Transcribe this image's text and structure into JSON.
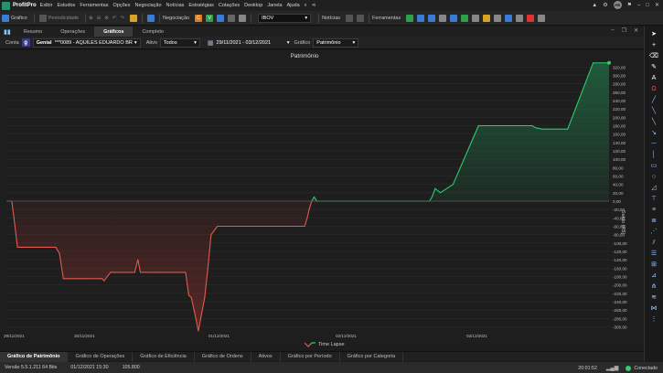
{
  "menubar": {
    "app_title": "ProfitPro",
    "items": [
      "Exibir",
      "Estudos",
      "Ferramentas",
      "Opções",
      "Negociação",
      "Notícias",
      "Estratégias",
      "Cotações",
      "Desktop",
      "Janela",
      "Ajuda"
    ],
    "avatar_text": "AE"
  },
  "toolbar": {
    "chart_label": "Gráfico",
    "periodicity_label": "Periodicidade",
    "negotiation_label": "Negociação",
    "buy_letter": "C",
    "sell_letter": "V",
    "symbol_value": "IBOV",
    "news_label": "Notícias",
    "tools_label": "Ferramentas"
  },
  "tabs": [
    {
      "label": "Resumo",
      "active": false
    },
    {
      "label": "Operações",
      "active": false
    },
    {
      "label": "Gráficos",
      "active": true
    },
    {
      "label": "Completo",
      "active": false
    }
  ],
  "filters": {
    "account_label": "Conta",
    "broker_icon_letter": "g",
    "broker_name": "Genial",
    "account_value": "***0089 - AQUILES EDUARDO BR",
    "asset_label": "Ativo",
    "asset_value": "Todos",
    "date_range": "29/11/2021 - 03/12/2021",
    "chart_label": "Gráfico",
    "chart_value": "Patrimônio"
  },
  "chart_data": {
    "type": "line",
    "title": "Patrimônio",
    "ylabel": "Saldo (R$)",
    "legend": "Time Lapse",
    "ylim": [
      -310,
      340
    ],
    "yticks": [
      320,
      300,
      280,
      260,
      240,
      220,
      200,
      180,
      160,
      140,
      120,
      100,
      80,
      60,
      40,
      20,
      0,
      -20,
      -40,
      -60,
      -80,
      -100,
      -120,
      -140,
      -160,
      -180,
      -200,
      -220,
      -240,
      -260,
      -280,
      -300
    ],
    "ytick_labels": [
      "320,00",
      "300,00",
      "280,00",
      "260,00",
      "240,00",
      "220,00",
      "200,00",
      "180,00",
      "160,00",
      "140,00",
      "120,00",
      "100,00",
      "80,00",
      "60,00",
      "40,00",
      "20,00",
      "0,00",
      "-20,00",
      "-40,00",
      "-60,00",
      "-80,00",
      "-100,00",
      "-120,00",
      "-140,00",
      "-160,00",
      "-180,00",
      "-200,00",
      "-220,00",
      "-240,00",
      "-260,00",
      "-280,00",
      "-300,00"
    ],
    "xtick_labels": [
      "29/11/2021",
      "30/11/2021",
      "01/12/2021",
      "02/12/2021",
      "03/12/2021"
    ],
    "x": [
      0,
      0.7,
      1.0,
      1.6,
      2.0,
      2.2,
      2.6,
      3.5,
      4.4,
      7.6,
      8.2,
      8.8,
      9.4,
      10.0,
      10.6,
      11.2,
      12.0,
      14.5,
      14.9,
      15.2,
      16.2,
      20.0,
      20.5,
      20.9,
      24.0,
      27.2,
      28.0,
      28.5,
      28.9,
      29.4,
      30.0,
      30.5,
      31.0,
      31.5,
      32.0,
      33.0,
      37.0,
      40.0,
      43.0,
      45.8,
      46.3,
      46.7,
      47.1,
      47.4,
      47.8,
      48.2,
      48.6,
      49.0,
      50.5,
      53.0,
      58.0,
      61.0,
      64.0,
      66.0,
      66.3,
      66.7,
      67.2,
      68.0,
      70.0,
      74.0,
      78.0,
      81.5,
      82.0,
      82.4,
      83.0,
      84.0,
      84.5,
      88.0,
      92.0,
      94.5
    ],
    "values": [
      0,
      0,
      -35,
      -110,
      -110,
      -110,
      -110,
      -110,
      -110,
      -110,
      -125,
      -185,
      -185,
      -185,
      -185,
      -185,
      -185,
      -185,
      -185,
      -190,
      -170,
      -170,
      -140,
      -170,
      -170,
      -170,
      -170,
      -225,
      -230,
      -265,
      -310,
      -270,
      -230,
      -160,
      -80,
      -60,
      -60,
      -60,
      -60,
      -60,
      -60,
      -60,
      -40,
      -20,
      0,
      10,
      0,
      0,
      0,
      0,
      0,
      0,
      0,
      0,
      0,
      10,
      30,
      20,
      40,
      180,
      180,
      180,
      180,
      180,
      175,
      172,
      172,
      172,
      330,
      330
    ]
  },
  "bottom_tabs": [
    {
      "label": "Gráfico de Patrimônio",
      "active": true
    },
    {
      "label": "Gráfico de Operações",
      "active": false
    },
    {
      "label": "Gráfico de Eficiência",
      "active": false
    },
    {
      "label": "Gráfico de Ordens",
      "active": false
    },
    {
      "label": "Ativos",
      "active": false
    },
    {
      "label": "Gráfico por Período",
      "active": false
    },
    {
      "label": "Gráfico por Categoria",
      "active": false
    }
  ],
  "status": {
    "version": "Versão 5.5.1.211 64 Bits",
    "datetime": "01/12/2021 15:30",
    "ping": "105.800",
    "clock": "20:01:52",
    "connection": "Conectado"
  },
  "colors": {
    "positive": "#2ecc71",
    "negative": "#e05a4e",
    "positive_fill": "#1f6e44",
    "negative_fill": "#6b2a27"
  }
}
